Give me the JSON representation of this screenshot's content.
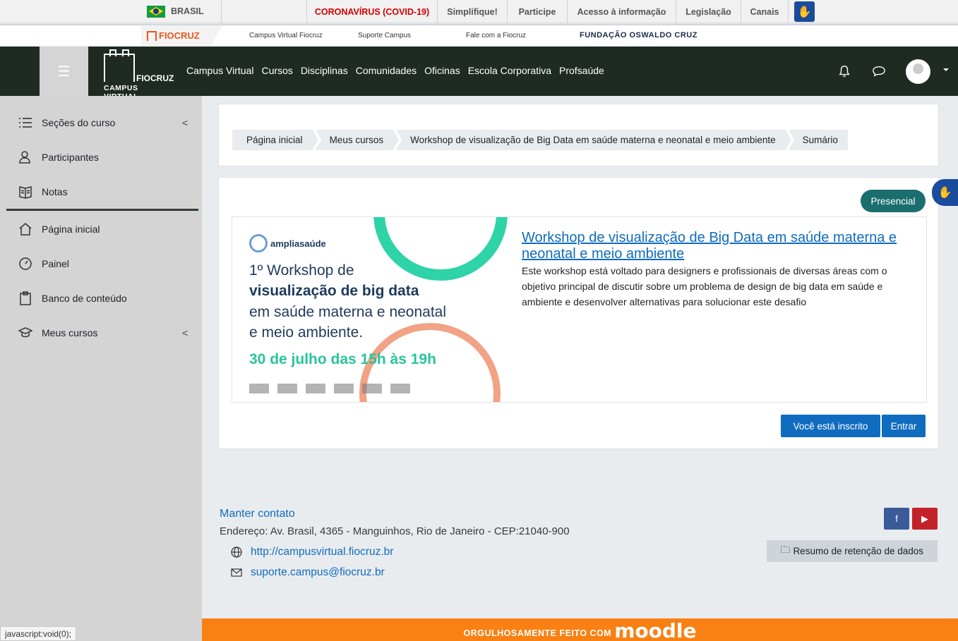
{
  "gov_bar": {
    "country": "BRASIL",
    "links": [
      "CORONAVÍRUS (COVID-19)",
      "Simplifique!",
      "Participe",
      "Acesso à informação",
      "Legislação",
      "Canais"
    ]
  },
  "fio_bar": {
    "logo_text": "FIOCRUZ",
    "links": [
      "Campus Virtual Fiocruz",
      "Suporte Campus",
      "Fale com a Fiocruz"
    ],
    "foundation": "FUNDAÇÃO OSWALDO CRUZ"
  },
  "navbar": {
    "brand_line1": "FIOCRUZ",
    "brand_line2": "CAMPUS VIRTUAL",
    "links": [
      "Campus Virtual",
      "Cursos",
      "Disciplinas",
      "Comunidades",
      "Oficinas",
      "Escola Corporativa",
      "Profsaúde"
    ]
  },
  "sidebar": {
    "items": [
      "Seções do curso",
      "Participantes",
      "Notas",
      "Página inicial",
      "Painel",
      "Banco de conteúdo",
      "Meus cursos"
    ]
  },
  "breadcrumb": [
    "Página inicial",
    "Meus cursos",
    "Workshop de visualização de Big Data em saúde materna e neonatal e meio ambiente",
    "Sumário"
  ],
  "course": {
    "badge": "Presencial",
    "title": "Workshop de visualização de Big Data em saúde materna e neonatal e meio ambiente",
    "description": "Este workshop está voltado para designers e profissionais de diversas áreas com o objetivo principal de discutir sobre um problema de design de big data em saúde e ambiente e desenvolver alternativas para solucionar este desafio",
    "banner": {
      "logo": "ampliasaúde",
      "line1": "1º Workshop de",
      "line2": "visualização de big data",
      "line3": "em saúde materna e neonatal",
      "line4": "e meio ambiente.",
      "line5": "30 de julho das 15h às 19h"
    },
    "enrolled_label": "Você está inscrito",
    "enter_label": "Entrar"
  },
  "footer": {
    "contact_heading": "Manter contato",
    "address": "Endereço: Av. Brasil, 4365 - Manguinhos, Rio de Janeiro - CEP:21040-900",
    "website": "http://campusvirtual.fiocruz.br",
    "email": "suporte.campus@fiocruz.br",
    "retention": "Resumo de retenção de dados",
    "made_with": "ORGULHOSAMENTE FEITO COM",
    "moodle": "moodle"
  },
  "status_bar": "javascript:void(0);",
  "colors": {
    "navbar": "#1e2a22",
    "primary": "#0f6cbf",
    "badge": "#1b6e6e",
    "covid": "#d10000",
    "moodle": "#f98012"
  }
}
